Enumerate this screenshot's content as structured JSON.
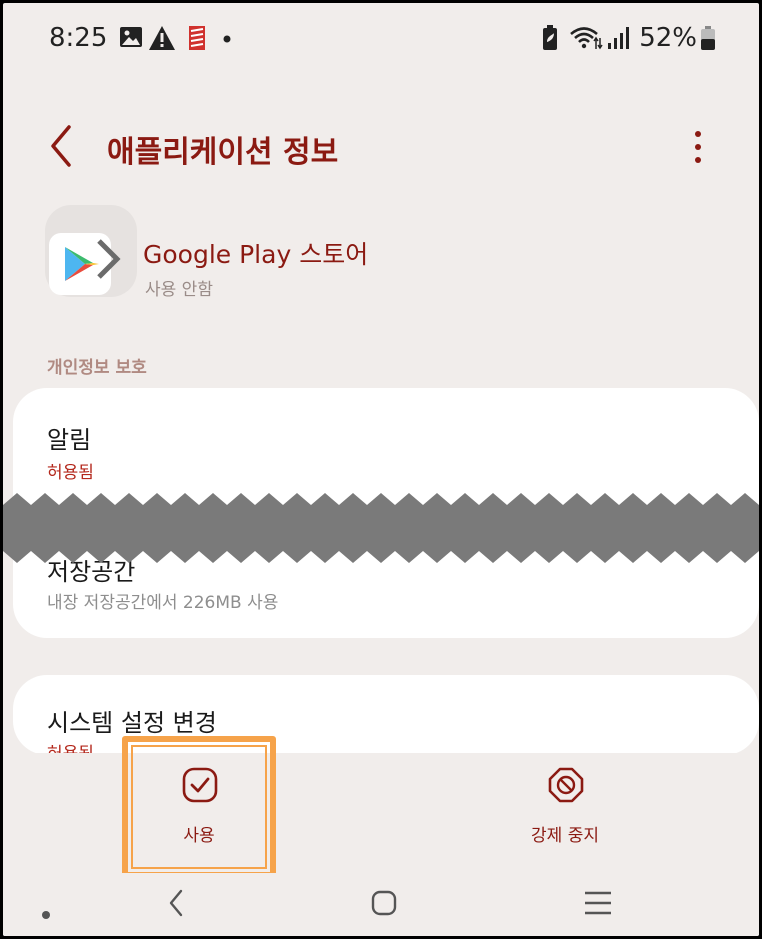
{
  "status_bar": {
    "time": "8:25",
    "battery_percent": "52%",
    "icons": [
      "image-icon",
      "warning-icon",
      "app-notification-icon",
      "dot-icon",
      "battery-saver-icon",
      "wifi-icon",
      "signal-icon",
      "battery-icon"
    ]
  },
  "header": {
    "title": "애플리케이션 정보",
    "back_icon": "chevron-left-icon",
    "more_icon": "more-vertical-icon"
  },
  "app": {
    "name": "Google Play 스토어",
    "status": "사용 안함",
    "icon": "google-play-icon"
  },
  "section": {
    "label": "개인정보 보호"
  },
  "items": [
    {
      "title": "알림",
      "subtitle": "허용됨"
    },
    {
      "title": "저장공간",
      "subtitle": "내장 저장공간에서 226MB 사용"
    },
    {
      "title": "시스템 설정 변경",
      "subtitle": "허용됨"
    }
  ],
  "actions": {
    "enable_label": "사용",
    "force_stop_label": "강제 중지"
  },
  "colors": {
    "accent": "#8b1a12",
    "allowed": "#b4281c",
    "highlight": "#f6a34a",
    "background": "#f1edeb"
  }
}
